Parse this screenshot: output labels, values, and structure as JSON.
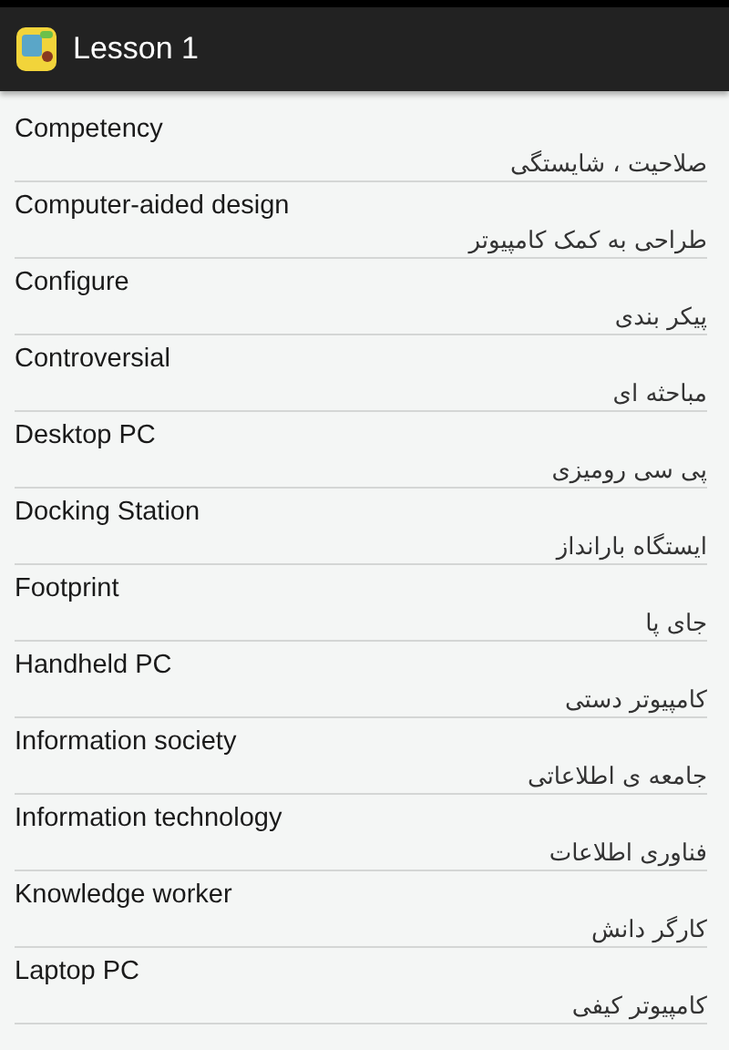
{
  "action_bar": {
    "title": "Lesson 1"
  },
  "words": [
    {
      "term": "Competency",
      "translation": "صلاحیت ، شایستگی"
    },
    {
      "term": "Computer-aided design",
      "translation": "طراحی به کمک کامپیوتر"
    },
    {
      "term": "Configure",
      "translation": "پیکر بندی"
    },
    {
      "term": "Controversial",
      "translation": "مباحثه ای"
    },
    {
      "term": "Desktop PC",
      "translation": "پی سی رومیزی"
    },
    {
      "term": "Docking Station",
      "translation": "ایستگاه بارانداز"
    },
    {
      "term": "Footprint",
      "translation": "جای پا"
    },
    {
      "term": "Handheld PC",
      "translation": "کامپیوتر دستی"
    },
    {
      "term": "Information society",
      "translation": "جامعه ی اطلاعاتی"
    },
    {
      "term": "Information technology",
      "translation": "فناوری اطلاعات"
    },
    {
      "term": "Knowledge worker",
      "translation": "کارگر دانش"
    },
    {
      "term": "Laptop PC",
      "translation": "کامپیوتر کیفی"
    }
  ]
}
